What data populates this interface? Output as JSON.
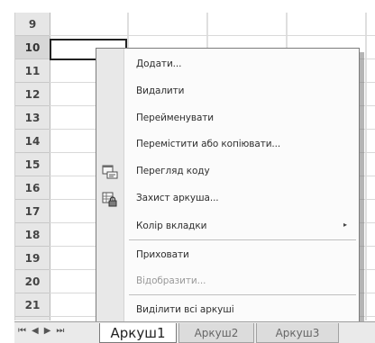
{
  "rows": {
    "labels": [
      "9",
      "10",
      "11",
      "12",
      "13",
      "14",
      "15",
      "16",
      "17",
      "18",
      "19",
      "20",
      "21"
    ]
  },
  "context_menu": {
    "items": [
      {
        "label": "Додати...",
        "enabled": true
      },
      {
        "label": "Видалити",
        "enabled": true
      },
      {
        "label": "Перейменувати",
        "enabled": true
      },
      {
        "label": "Перемістити або копіювати...",
        "enabled": true
      },
      {
        "label": "Перегляд коду",
        "enabled": true,
        "icon": "view-code-icon"
      },
      {
        "label": "Захист аркуша...",
        "enabled": true,
        "icon": "protect-sheet-icon"
      },
      {
        "label": "Колір вкладки",
        "enabled": true,
        "has_submenu": true,
        "submenu_arrow": "▸"
      },
      {
        "label": "Приховати",
        "enabled": true
      },
      {
        "label": "Відобразити...",
        "enabled": false
      },
      {
        "label": "Виділити всі аркуші",
        "enabled": true
      }
    ]
  },
  "tabs": {
    "nav": [
      "⏮",
      "◀",
      "▶",
      "⏭"
    ],
    "sheets": [
      "Аркуш1",
      "Аркуш2",
      "Аркуш3"
    ],
    "active": "Аркуш1"
  }
}
